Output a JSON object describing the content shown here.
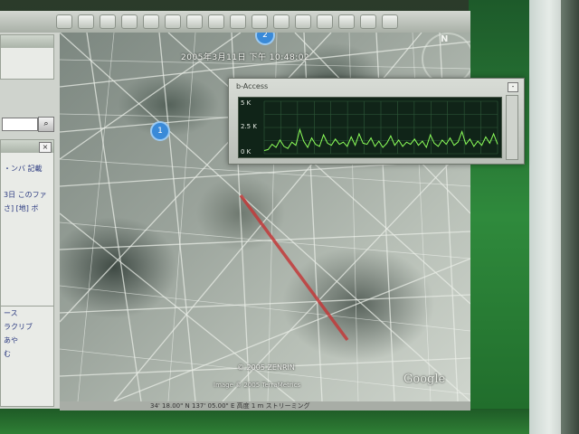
{
  "map": {
    "timestamp": "2005年3月11日 下午 10:48:02",
    "copyright": "© 2005 ZENRIN",
    "image_credit": "Image © 2005 TerraMetrics",
    "brand": "Google",
    "compass_label": "N",
    "pins": [
      "1",
      "2"
    ]
  },
  "sidebar": {
    "close_glyph": "×",
    "search_glyph": "⌕",
    "panel_lines": [
      "・ンバ 記載",
      "3日 このファ",
      "さ] [地] ボ"
    ],
    "lower_lines": [
      "ース",
      "ラクリブ",
      "あや",
      "む"
    ]
  },
  "statusbar": {
    "text": "34' 18.00\" N  137' 05.00\" E  高度 1 m   ストリーミング"
  },
  "graph_window": {
    "title": "b-Access",
    "min_glyph": "-",
    "y_labels": [
      "5 K",
      "2.5 K",
      "0 K"
    ],
    "chart_data": {
      "type": "line",
      "ylim": [
        0,
        5
      ],
      "series": [
        {
          "color": "#8cff5a",
          "values": [
            0.3,
            0.4,
            0.9,
            0.6,
            1.3,
            0.7,
            0.5,
            1.1,
            0.8,
            2.3,
            1.2,
            0.6,
            1.5,
            0.9,
            0.7,
            1.8,
            1.0,
            0.8,
            1.4,
            0.9,
            1.1,
            0.7,
            1.6,
            0.8,
            1.9,
            1.0,
            0.9,
            1.5,
            0.7,
            1.2,
            0.6,
            1.0,
            1.7,
            0.8,
            1.3,
            0.7,
            1.1,
            0.9,
            1.4,
            0.8,
            1.2,
            0.6,
            1.8,
            1.0,
            0.7,
            1.3,
            0.9,
            1.5,
            0.8,
            1.1,
            2.1,
            0.9,
            1.4,
            0.7,
            1.2,
            0.8,
            1.6,
            1.0,
            1.9,
            0.9
          ]
        }
      ]
    }
  }
}
